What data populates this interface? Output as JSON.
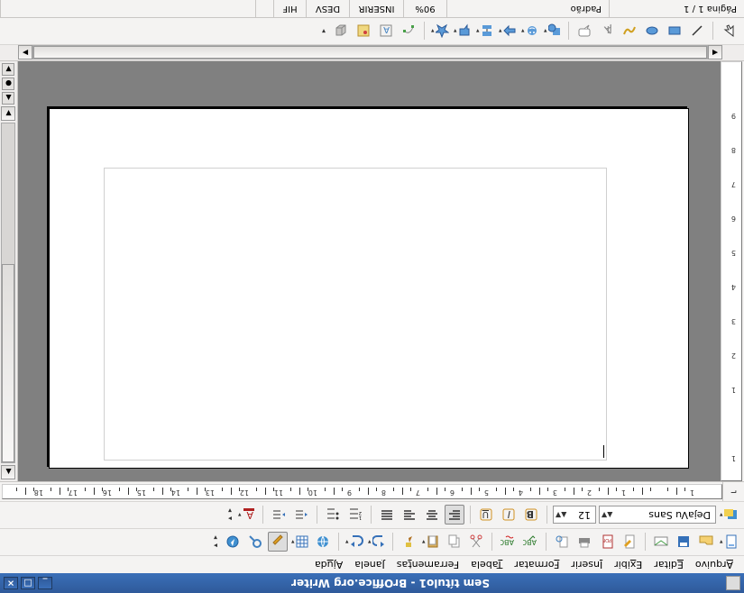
{
  "window": {
    "title": "Sem título1 - BrOffice.org Writer",
    "min_label": "_",
    "max_label": "□",
    "close_label": "×"
  },
  "menu": {
    "arquivo": "Arquivo",
    "editar": "Editar",
    "exibir": "Exibir",
    "inserir": "Inserir",
    "formatar": "Formatar",
    "tabela": "Tabela",
    "ferramentas": "Ferramentas",
    "janela": "Janela",
    "ajuda": "Ajuda"
  },
  "formatbar": {
    "font_name": "DejaVu Sans",
    "font_size": "12"
  },
  "ruler_numbers": [
    "1",
    "",
    "1",
    "2",
    "3",
    "4",
    "5",
    "6",
    "7",
    "8",
    "9",
    "10",
    "11",
    "12",
    "13",
    "14",
    "15",
    "16",
    "17",
    "18"
  ],
  "vruler_numbers": [
    "1",
    "",
    "1",
    "2",
    "3",
    "4",
    "5",
    "6",
    "7",
    "8",
    "9"
  ],
  "status": {
    "page": "Página 1 / 1",
    "style": "Padrão",
    "zoom": "90%",
    "mode": "INSERIR",
    "sel": "DESV",
    "hif": "HIF"
  }
}
